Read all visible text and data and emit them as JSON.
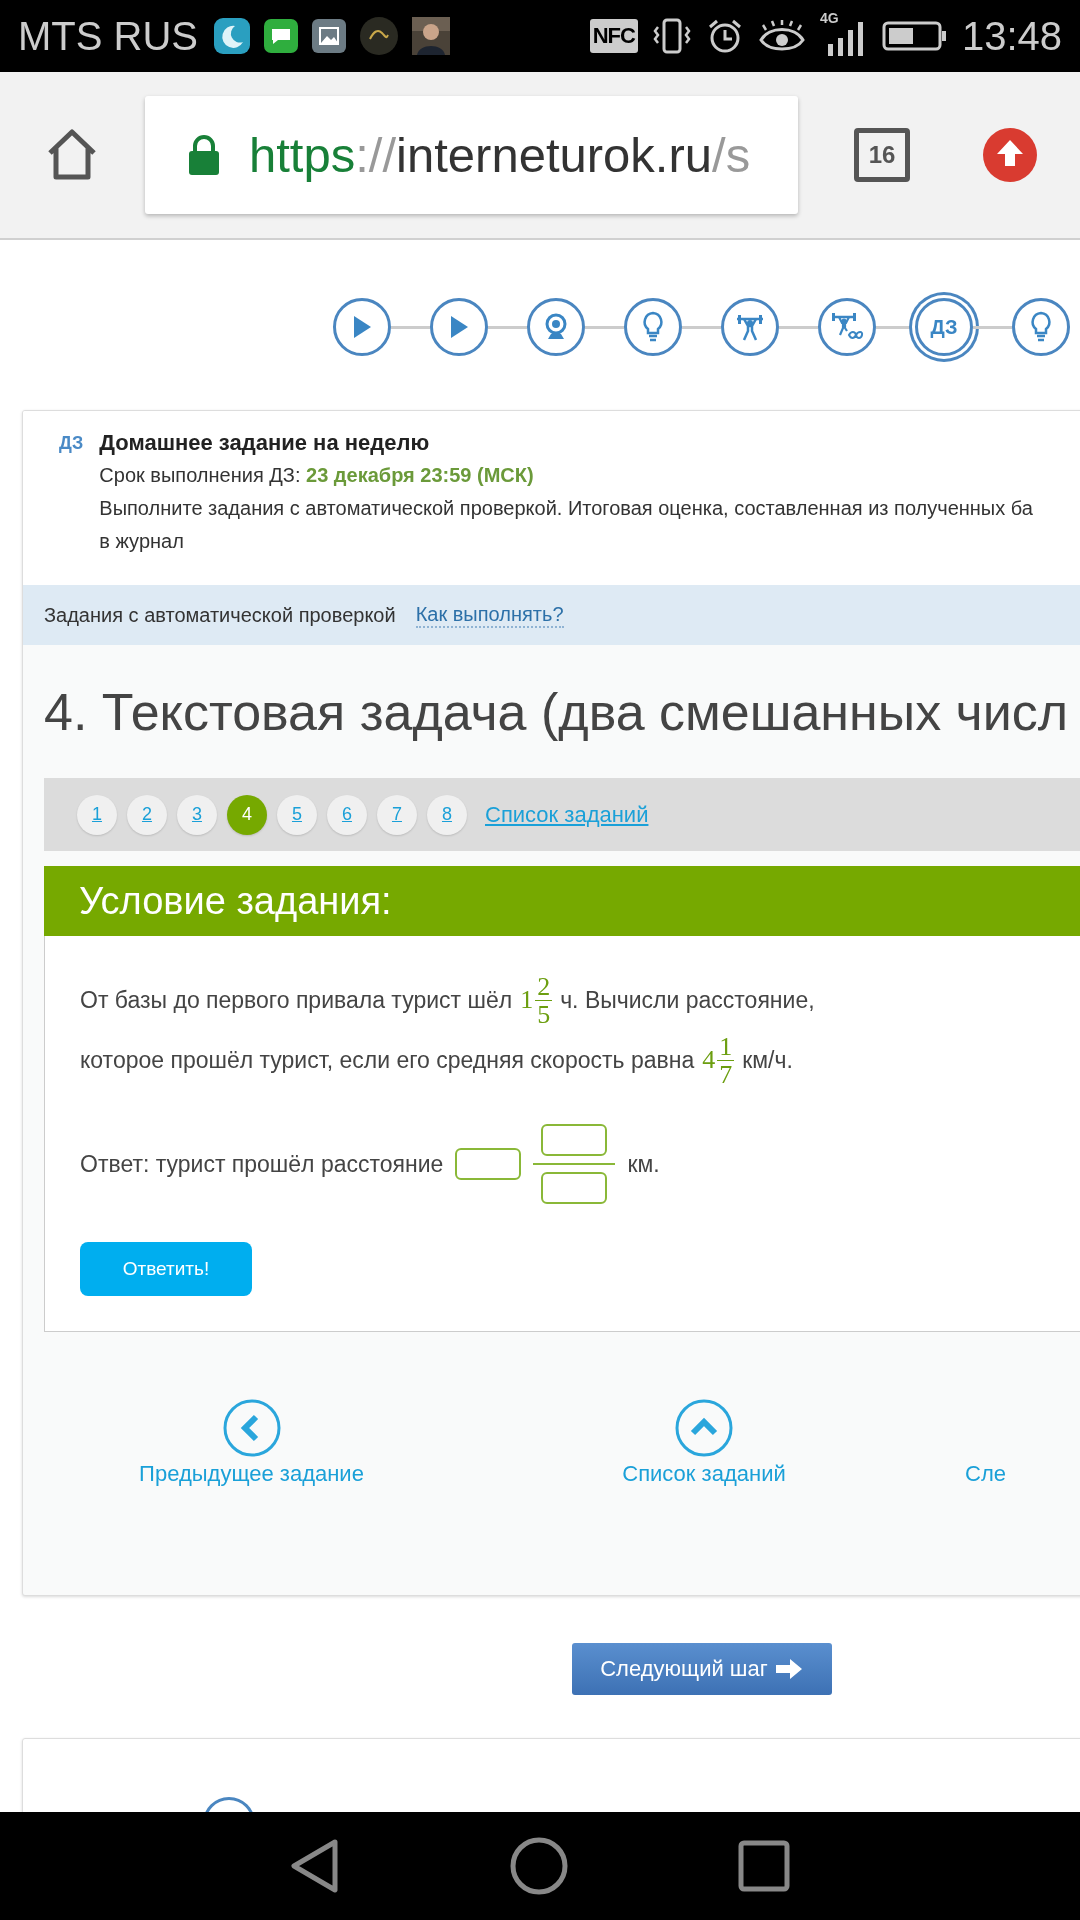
{
  "status_bar": {
    "carrier": "MTS RUS",
    "nfc": "NFC",
    "network": "4G",
    "time": "13:48"
  },
  "browser": {
    "url_scheme": "https",
    "url_separator": "://",
    "url_host": "interneturok.ru",
    "url_path": "/s",
    "tab_count": "16"
  },
  "steps": [
    {
      "kind": "play",
      "selected": false
    },
    {
      "kind": "play",
      "selected": false
    },
    {
      "kind": "webcam",
      "selected": false
    },
    {
      "kind": "bulb",
      "selected": false
    },
    {
      "kind": "lifter",
      "selected": false
    },
    {
      "kind": "lifter-infinity",
      "selected": false
    },
    {
      "kind": "homework",
      "label": "ДЗ",
      "selected": true
    },
    {
      "kind": "bulb",
      "selected": false
    }
  ],
  "homework": {
    "badge": "ДЗ",
    "title": "Домашнее задание на неделю",
    "deadline": "Срок выполнения ДЗ: **23 декабря 23:59 (МСК)**",
    "description_lines": [
      "Выполните задания с автоматической проверкой. Итоговая оценка, составленная из полученных ба",
      "в журнал"
    ]
  },
  "auto_check": {
    "label": "Задания с автоматической проверкой",
    "link": "Как выполнять?"
  },
  "task_title": "4. Текстовая задача (два смешанных числ",
  "task_numbers": [
    {
      "label": "1",
      "selected": false
    },
    {
      "label": "2",
      "selected": false
    },
    {
      "label": "3",
      "selected": false
    },
    {
      "label": "4",
      "selected": true
    },
    {
      "label": "5",
      "selected": false
    },
    {
      "label": "6",
      "selected": false
    },
    {
      "label": "7",
      "selected": false
    },
    {
      "label": "8",
      "selected": false
    }
  ],
  "task_list_link": "Список заданий",
  "condition": {
    "heading": "Условие задания:",
    "lines": [
      {
        "before": "От базы до первого привала турист шёл",
        "fraction": {
          "whole": "1",
          "numerator": "2",
          "denominator": "5"
        },
        "after": "ч. Вычисли расстояние,"
      },
      {
        "before": "которое прошёл турист, если его средняя скорость равна",
        "fraction": {
          "whole": "4",
          "numerator": "1",
          "denominator": "7"
        },
        "after": "км/ч."
      }
    ],
    "answer_label": "Ответ: турист прошёл расстояние",
    "answer_unit": "км.",
    "submit": "Ответить!"
  },
  "nav": [
    {
      "kind": "prev",
      "label": "Предыдущее задание"
    },
    {
      "kind": "list",
      "label": "Список заданий"
    },
    {
      "kind": "next",
      "label": "Сле"
    }
  ],
  "next_step": "Следующий шаг"
}
